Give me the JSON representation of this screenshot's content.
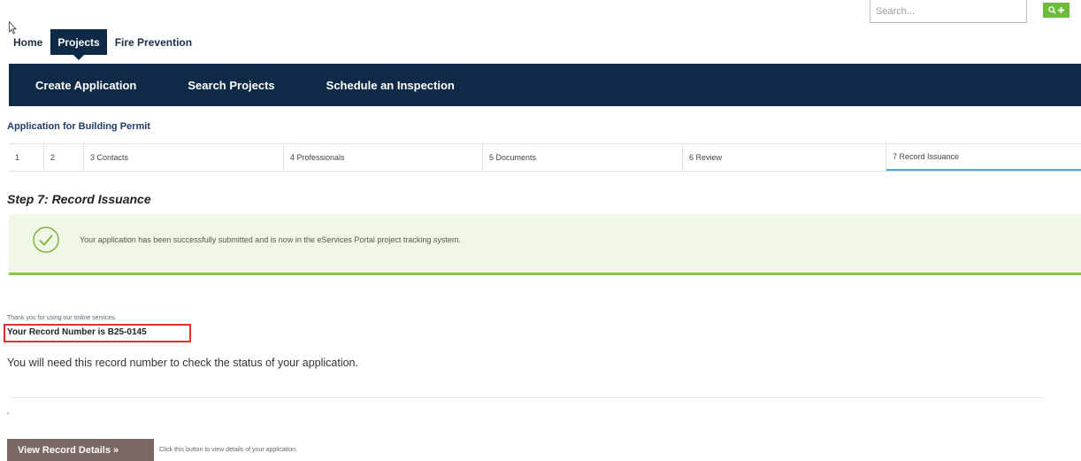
{
  "search": {
    "placeholder": "Search..."
  },
  "top_nav": {
    "home": "Home",
    "projects": "Projects",
    "fire_prevention": "Fire Prevention"
  },
  "menu": {
    "create_application": "Create Application",
    "search_projects": "Search Projects",
    "schedule_inspection": "Schedule an Inspection"
  },
  "page": {
    "app_title": "Application for Building Permit",
    "step_heading": "Step 7: Record Issuance"
  },
  "steps": [
    {
      "label": "1"
    },
    {
      "label": "2"
    },
    {
      "label": "3 Contacts"
    },
    {
      "label": "4 Professionals"
    },
    {
      "label": "5 Documents"
    },
    {
      "label": "6 Review"
    },
    {
      "label": "7 Record Issuance"
    }
  ],
  "notice": {
    "message": "Your application has been successfully submitted and is now in the eServices Portal project tracking system."
  },
  "result": {
    "thanks": "Thank you for using our online services.",
    "record_number": "Your Record Number is B25-0145",
    "need_text": "You will need this record number to check the status of your application."
  },
  "actions": {
    "view_details": "View Record Details »",
    "view_hint": "Click this button to view details of your application."
  },
  "colors": {
    "nav_blue": "#0f2a47",
    "success_green": "#8cc63f",
    "highlight_red": "#e0332e",
    "button_brown": "#7b6763"
  }
}
